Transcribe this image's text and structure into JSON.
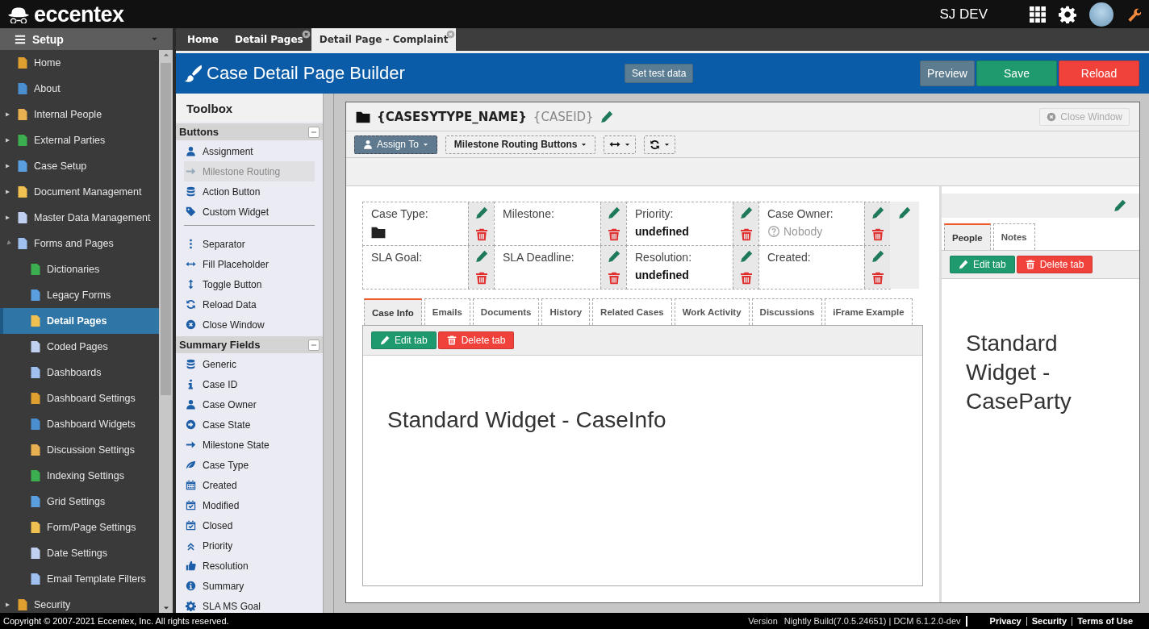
{
  "header": {
    "logo": "eccentex",
    "user": "SJ DEV"
  },
  "sidebar": {
    "title": "Setup",
    "items": [
      {
        "label": "Home",
        "selected": false
      },
      {
        "label": "About",
        "selected": false
      },
      {
        "label": "Internal People",
        "expanded": false,
        "selected": false
      },
      {
        "label": "External Parties",
        "expanded": false,
        "selected": false
      },
      {
        "label": "Case Setup",
        "expanded": false,
        "selected": false
      },
      {
        "label": "Document Management",
        "expanded": false,
        "selected": false
      },
      {
        "label": "Master Data Management",
        "expanded": false,
        "selected": false
      },
      {
        "label": "Forms and Pages",
        "expanded": true,
        "selected": false,
        "children": [
          {
            "label": "Dictionaries",
            "selected": false
          },
          {
            "label": "Legacy Forms",
            "selected": false
          },
          {
            "label": "Detail Pages",
            "selected": true
          },
          {
            "label": "Coded Pages",
            "selected": false
          },
          {
            "label": "Dashboards",
            "selected": false
          },
          {
            "label": "Dashboard Settings",
            "selected": false
          },
          {
            "label": "Dashboard Widgets",
            "selected": false
          },
          {
            "label": "Discussion Settings",
            "selected": false
          },
          {
            "label": "Indexing Settings",
            "selected": false
          },
          {
            "label": "Grid Settings",
            "selected": false
          },
          {
            "label": "Form/Page Settings",
            "selected": false
          },
          {
            "label": "Date Settings",
            "selected": false
          },
          {
            "label": "Email Template Filters",
            "selected": false
          }
        ]
      },
      {
        "label": "Security",
        "expanded": false,
        "selected": false
      }
    ]
  },
  "tabs": [
    {
      "label": "Home",
      "closable": false,
      "selected": false
    },
    {
      "label": "Detail Pages",
      "closable": true,
      "selected": false
    },
    {
      "label": "Detail Page - Complaint",
      "closable": true,
      "selected": true
    }
  ],
  "builder": {
    "title": "Case Detail Page Builder",
    "test_button": "Set test data",
    "buttons": [
      {
        "label": "Preview",
        "kind": "preview"
      },
      {
        "label": "Save",
        "kind": "save"
      },
      {
        "label": "Reload",
        "kind": "reload"
      }
    ]
  },
  "toolbox": {
    "title": "Toolbox",
    "sections": [
      {
        "title": "Buttons",
        "expanded": true,
        "groups": [
          [
            {
              "label": "Assignment",
              "disabled": false
            },
            {
              "label": "Milestone Routing",
              "disabled": true
            },
            {
              "label": "Action Button",
              "disabled": false
            },
            {
              "label": "Custom Widget",
              "disabled": false
            }
          ],
          [
            {
              "label": "Separator",
              "disabled": false
            },
            {
              "label": "Fill Placeholder",
              "disabled": false
            },
            {
              "label": "Toggle Button",
              "disabled": false
            },
            {
              "label": "Reload Data",
              "disabled": false
            },
            {
              "label": "Close Window",
              "disabled": false
            }
          ]
        ]
      },
      {
        "title": "Summary Fields",
        "expanded": true,
        "groups": [
          [
            {
              "label": "Generic",
              "disabled": false
            },
            {
              "label": "Case ID",
              "disabled": false
            },
            {
              "label": "Case Owner",
              "disabled": false
            },
            {
              "label": "Case State",
              "disabled": false
            },
            {
              "label": "Milestone State",
              "disabled": false
            },
            {
              "label": "Case Type",
              "disabled": false
            },
            {
              "label": "Created",
              "disabled": false
            },
            {
              "label": "Modified",
              "disabled": false
            },
            {
              "label": "Closed",
              "disabled": false
            },
            {
              "label": "Priority",
              "disabled": false
            },
            {
              "label": "Resolution",
              "disabled": false
            },
            {
              "label": "Summary",
              "disabled": false
            },
            {
              "label": "SLA MS Goal",
              "disabled": false
            }
          ]
        ]
      }
    ]
  },
  "canvas": {
    "title": "{CASESYTYPE_NAME}",
    "case_id": "{CASEID}",
    "close_button": {
      "label": "Close Window",
      "disabled": true
    },
    "toolbar": [
      {
        "kind": "assign",
        "label": "Assign To"
      },
      {
        "kind": "routing",
        "label": "Milestone Routing Buttons"
      },
      {
        "kind": "fill"
      },
      {
        "kind": "reload"
      }
    ],
    "summary": [
      [
        {
          "label": "Case Type:",
          "kind": "icon"
        },
        {
          "label": "Milestone:"
        },
        {
          "label": "Priority:",
          "kind": "text",
          "value": "undefined"
        },
        {
          "label": "Case Owner:",
          "kind": "empty",
          "value": "Nobody"
        }
      ],
      [
        {
          "label": "SLA Goal:"
        },
        {
          "label": "SLA Deadline:"
        },
        {
          "label": "Resolution:",
          "kind": "text",
          "value": "undefined"
        },
        {
          "label": "Created:"
        }
      ]
    ],
    "tabs": [
      {
        "label": "Case Info",
        "selected": true
      },
      {
        "label": "Emails",
        "selected": false
      },
      {
        "label": "Documents",
        "selected": false
      },
      {
        "label": "History",
        "selected": false
      },
      {
        "label": "Related Cases",
        "selected": false
      },
      {
        "label": "Work Activity",
        "selected": false
      },
      {
        "label": "Discussions",
        "selected": false
      },
      {
        "label": "iFrame Example",
        "selected": false
      }
    ],
    "tab_actions": [
      {
        "label": "Edit tab",
        "kind": "edit"
      },
      {
        "label": "Delete tab",
        "kind": "delete"
      }
    ],
    "widget": "Standard Widget - CaseInfo"
  },
  "side_panel": {
    "tabs": [
      {
        "label": "People",
        "selected": true
      },
      {
        "label": "Notes",
        "selected": false
      }
    ],
    "tab_actions": [
      {
        "label": "Edit tab",
        "kind": "edit"
      },
      {
        "label": "Delete tab",
        "kind": "delete"
      }
    ],
    "widget": "Standard Widget - CaseParty"
  },
  "footer": {
    "copyright": "Copyright © 2007-2021 Eccentex, Inc. All rights reserved.",
    "version_label": "Version",
    "version": "Nightly Build(7.0.5.24651) | DCM 6.1.2.0-dev",
    "links": [
      "Privacy",
      "Security",
      "Terms of Use"
    ]
  }
}
